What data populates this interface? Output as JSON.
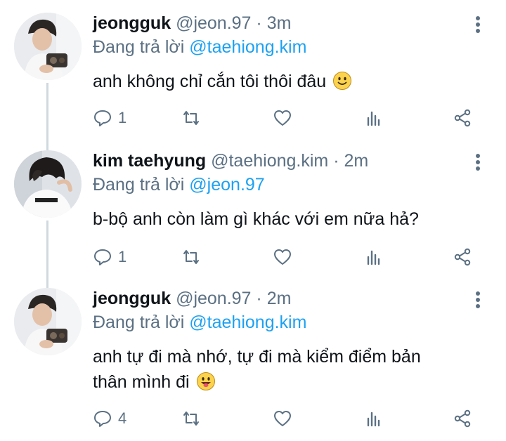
{
  "tweets": [
    {
      "name": "jeongguk",
      "handle": "@jeon.97",
      "separator": "·",
      "time": "3m",
      "reply_prefix": "Đang trả lời",
      "reply_to": "@taehiong.kim",
      "text": "anh không chỉ cắn tôi thôi đâu",
      "emoji": "slightly-smiling-face",
      "reply_count": "1",
      "avatar": "avatar-jeongguk"
    },
    {
      "name": "kim taehyung",
      "handle": "@taehiong.kim",
      "separator": "·",
      "time": "2m",
      "reply_prefix": "Đang trả lời",
      "reply_to": "@jeon.97",
      "text": "b-bộ anh còn làm gì khác với em nữa hả?",
      "emoji": "",
      "reply_count": "1",
      "avatar": "avatar-taehyung"
    },
    {
      "name": "jeongguk",
      "handle": "@jeon.97",
      "separator": "·",
      "time": "2m",
      "reply_prefix": "Đang trả lời",
      "reply_to": "@taehiong.kim",
      "text_line1": "anh tự đi mà nhớ, tự đi mà kiểm điểm bản",
      "text_line2": "thân mình đi",
      "emoji": "grinning-face-with-tongue",
      "reply_count": "4",
      "avatar": "avatar-jeongguk"
    }
  ],
  "icons": {
    "reply": "reply-icon",
    "retweet": "retweet-icon",
    "like": "heart-icon",
    "analytics": "analytics-icon",
    "share": "share-icon",
    "more": "more-vertical-icon"
  },
  "colors": {
    "link": "#1da1f2",
    "secondary": "#5b7083",
    "thread_line": "#cfd9de",
    "text": "#0f1419"
  }
}
